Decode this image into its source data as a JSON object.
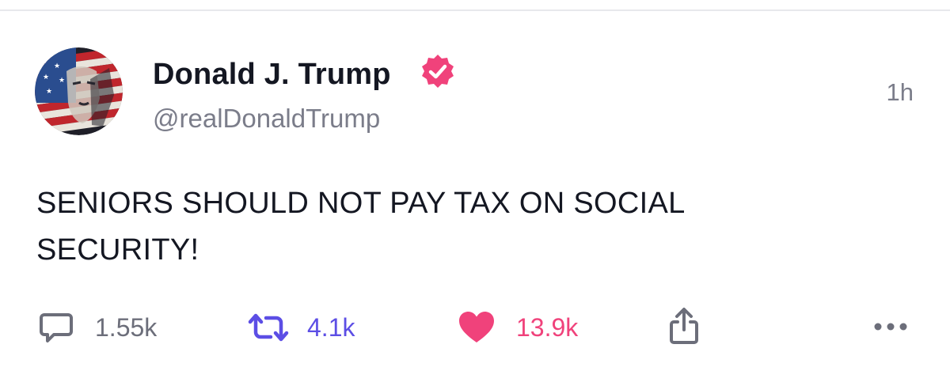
{
  "post": {
    "author": {
      "display_name": "Donald J. Trump",
      "handle": "@realDonaldTrump",
      "verified": true
    },
    "timestamp": "1h",
    "text_lines": [
      "SENIORS SHOULD NOT PAY TAX ON SOCIAL",
      "SECURITY!"
    ]
  },
  "actions": {
    "reply": {
      "icon": "comment-icon",
      "count": "1.55k"
    },
    "repost": {
      "icon": "repost-icon",
      "count": "4.1k",
      "color": "#5c4ee5"
    },
    "like": {
      "icon": "heart-icon",
      "count": "13.9k",
      "color": "#f0427b"
    },
    "share": {
      "icon": "share-icon"
    },
    "more": {
      "icon": "more-icon"
    }
  },
  "colors": {
    "verified_badge": "#f0427b",
    "text_primary": "#141722",
    "text_secondary": "#7b7d8a"
  }
}
